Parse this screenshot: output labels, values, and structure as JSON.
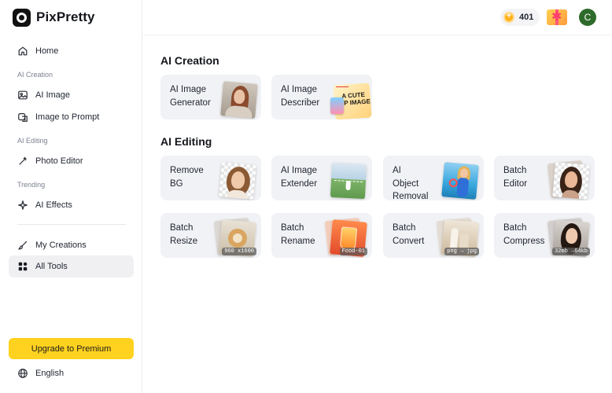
{
  "app": {
    "name": "PixPretty"
  },
  "sidebar": {
    "home": "Home",
    "section_ai_creation": "AI Creation",
    "ai_image": "AI Image",
    "image_to_prompt": "Image to Prompt",
    "section_ai_editing": "AI Editing",
    "photo_editor": "Photo Editor",
    "section_trending": "Trending",
    "ai_effects": "AI Effects",
    "my_creations": "My Creations",
    "all_tools": "All Tools",
    "upgrade": "Upgrade to Premium",
    "language": "English"
  },
  "header": {
    "credits": "401",
    "avatar_initial": "C"
  },
  "main": {
    "ai_creation_title": "AI Creation",
    "ai_editing_title": "AI Editing",
    "creation_tools": [
      {
        "label": "AI Image\nGenerator"
      },
      {
        "label": "AI Image\nDescriber",
        "thumb_text": "A CUTE\nIP IMAGE"
      }
    ],
    "editing_tools": [
      {
        "label": "Remove\nBG"
      },
      {
        "label": "AI Image\nExtender"
      },
      {
        "label": "AI\nObject\nRemoval"
      },
      {
        "label": "Batch\nEditor"
      },
      {
        "label": "Batch\nResize",
        "tag": "960 x1600"
      },
      {
        "label": "Batch\nRename",
        "tag": "Food-01"
      },
      {
        "label": "Batch\nConvert",
        "tag": "png → jpg"
      },
      {
        "label": "Batch\nCompress",
        "tag": "32mb →64kb"
      }
    ]
  },
  "colors": {
    "accent": "#ffd21f",
    "card_bg": "#f1f2f5",
    "avatar": "#2e6b2a",
    "coin": "#ffb21e"
  }
}
